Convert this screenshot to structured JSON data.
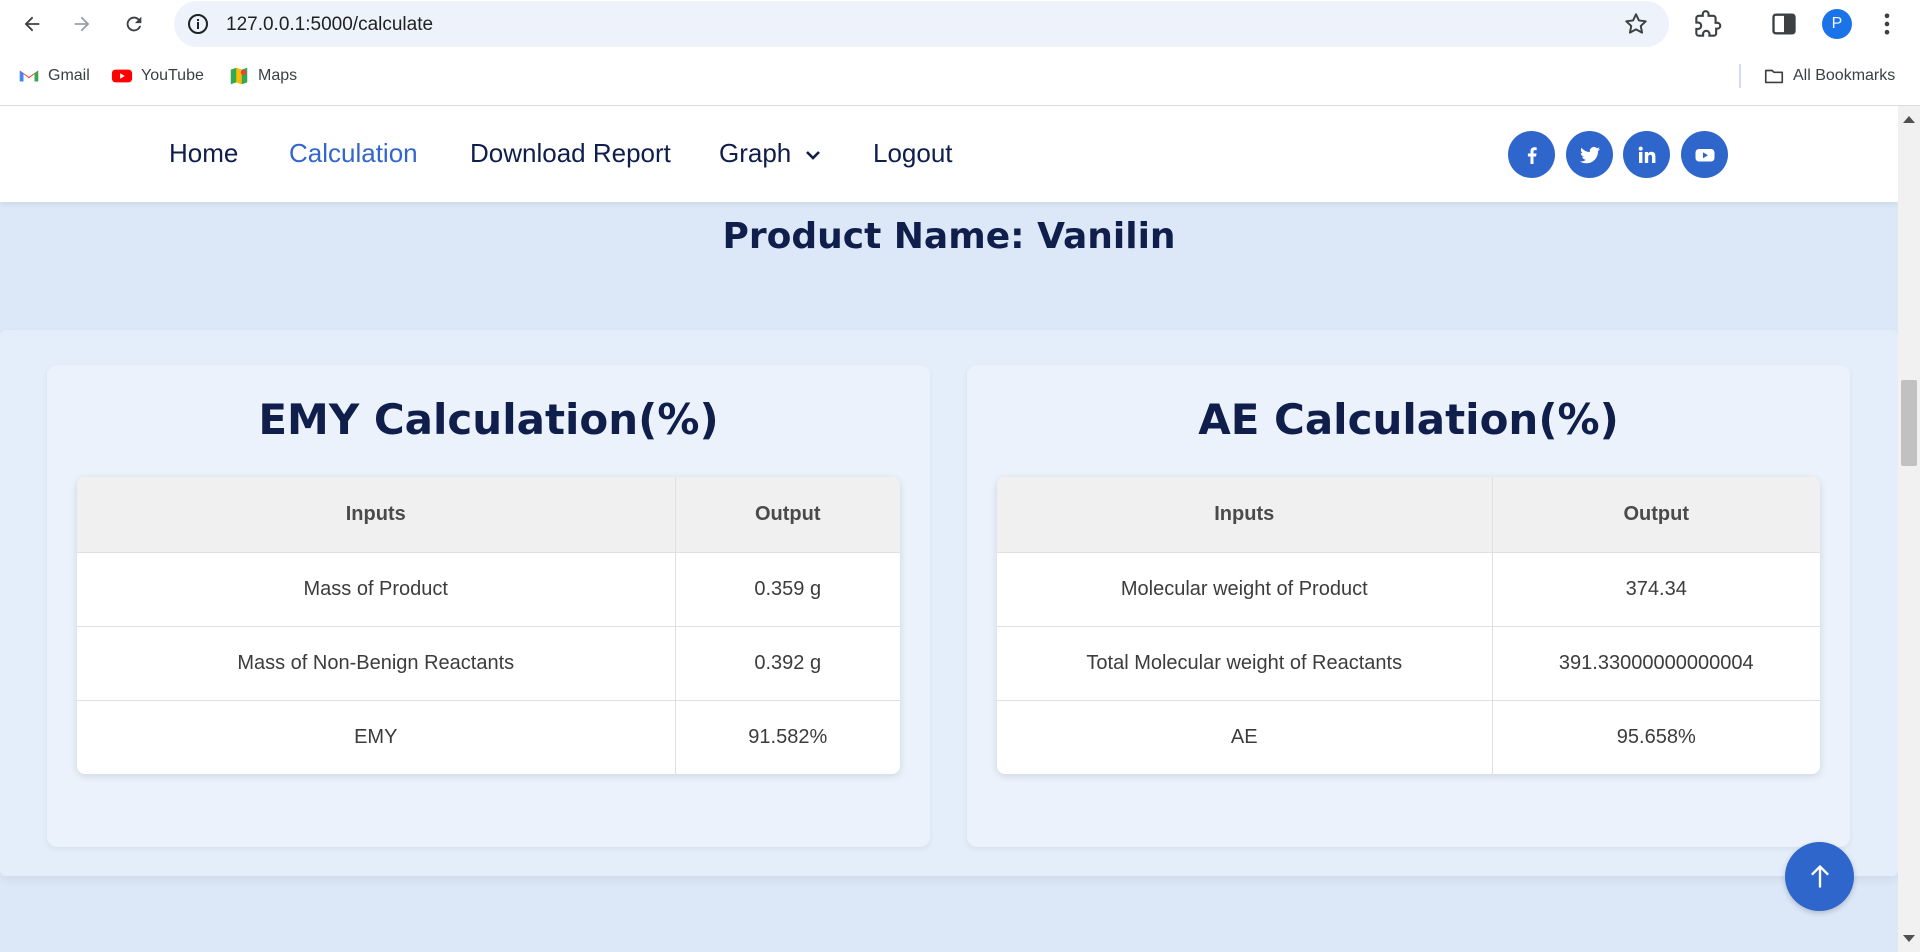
{
  "browser": {
    "url": "127.0.0.1:5000/calculate",
    "profile_initial": "P",
    "bookmarks": [
      {
        "label": "Gmail",
        "icon": "gmail-icon"
      },
      {
        "label": "YouTube",
        "icon": "youtube-icon"
      },
      {
        "label": "Maps",
        "icon": "maps-icon"
      }
    ],
    "all_bookmarks_label": "All Bookmarks"
  },
  "nav": {
    "items": [
      {
        "label": "Home",
        "active": false
      },
      {
        "label": "Calculation",
        "active": true
      },
      {
        "label": "Download Report",
        "active": false
      },
      {
        "label": "Graph",
        "active": false,
        "dropdown": true
      },
      {
        "label": "Logout",
        "active": false
      }
    ],
    "social": [
      "facebook-icon",
      "twitter-icon",
      "linkedin-icon",
      "youtube-icon"
    ],
    "accent_color": "#2f66cc"
  },
  "product_title": "Product Name: Vanilin",
  "emy": {
    "title": "EMY Calculation(%)",
    "headers": [
      "Inputs",
      "Output"
    ],
    "rows": [
      [
        "Mass of Product",
        "0.359 g"
      ],
      [
        "Mass of Non-Benign Reactants",
        "0.392 g"
      ],
      [
        "EMY",
        "91.582%"
      ]
    ]
  },
  "ae": {
    "title": "AE Calculation(%)",
    "headers": [
      "Inputs",
      "Output"
    ],
    "rows": [
      [
        "Molecular weight of Product",
        "374.34"
      ],
      [
        "Total Molecular weight of Reactants",
        "391.33000000000004"
      ],
      [
        "AE",
        "95.658%"
      ]
    ]
  }
}
